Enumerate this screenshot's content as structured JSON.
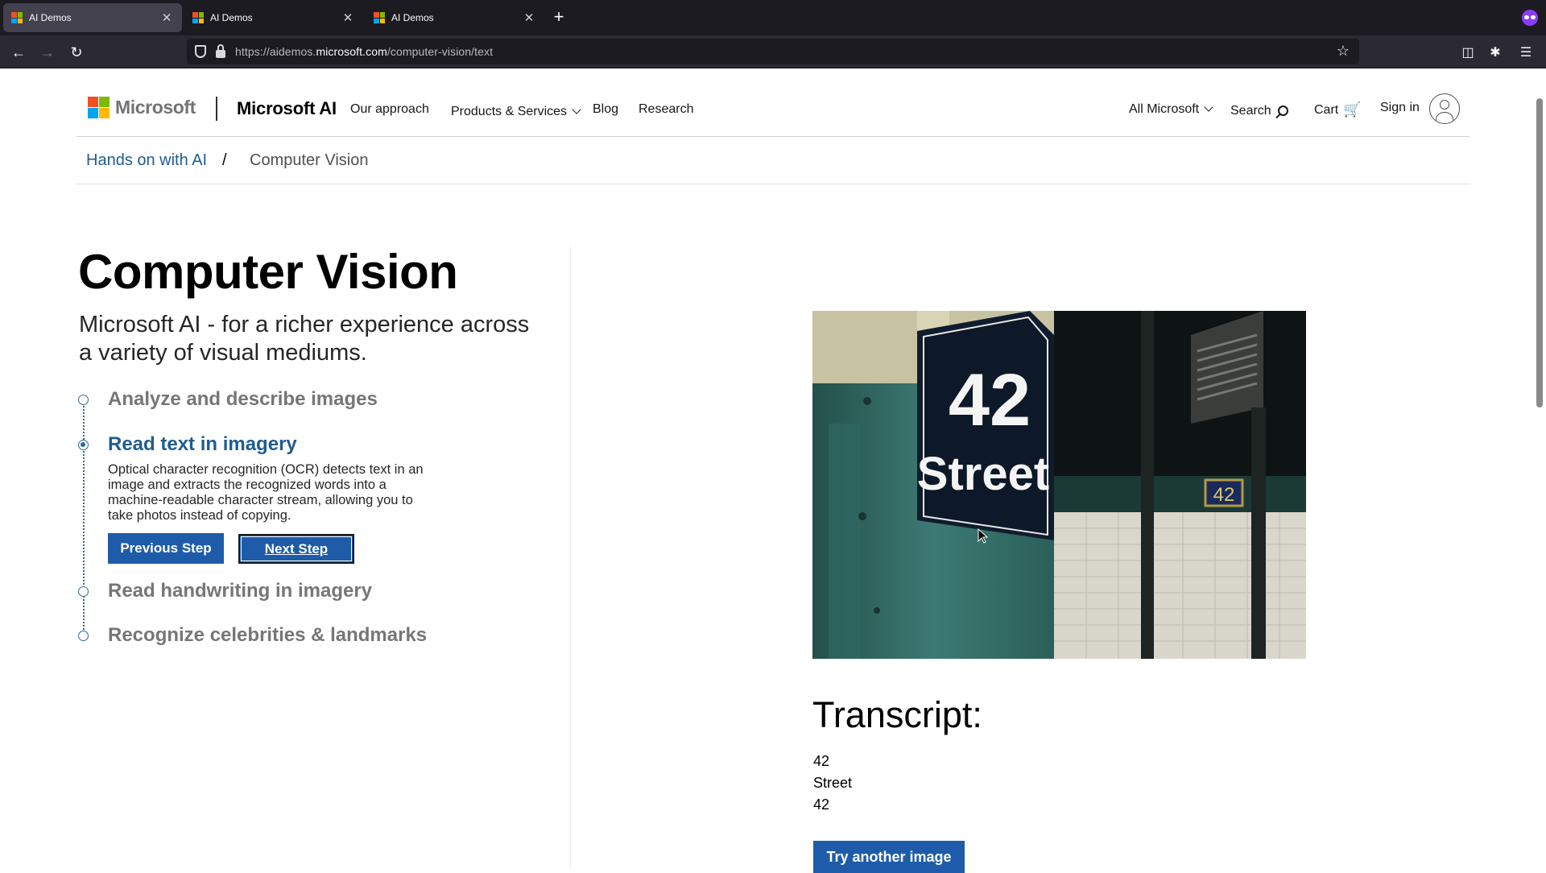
{
  "browser": {
    "tabs": [
      {
        "title": "AI Demos",
        "active": true
      },
      {
        "title": "AI Demos",
        "active": false
      },
      {
        "title": "AI Demos",
        "active": false
      }
    ],
    "new_tab": "+",
    "url_prefix": "https://aidemos.",
    "url_domain": "microsoft.com",
    "url_path": "/computer-vision/text"
  },
  "header": {
    "logo_text": "Microsoft",
    "brand": "Microsoft AI",
    "nav": [
      "Our approach",
      "Products & Services",
      "Blog",
      "Research"
    ],
    "all_microsoft": "All Microsoft",
    "search": "Search",
    "cart": "Cart",
    "sign_in": "Sign in"
  },
  "breadcrumb": {
    "link": "Hands on with AI",
    "separator": "/",
    "current": "Computer Vision"
  },
  "main": {
    "title": "Computer Vision",
    "subtitle": "Microsoft AI - for a richer experience across a variety of visual mediums.",
    "steps": [
      {
        "label": "Analyze and describe images",
        "active": false
      },
      {
        "label": "Read text in imagery",
        "active": true
      },
      {
        "label": "Read handwriting in imagery",
        "active": false
      },
      {
        "label": "Recognize celebrities & landmarks",
        "active": false
      }
    ],
    "step_description": "Optical character recognition (OCR) detects text in an image and extracts the recognized words into a machine-readable character stream, allowing you to take photos instead of copying.",
    "prev_button": "Previous Step",
    "next_button": "Next Step"
  },
  "result": {
    "sign_number": "42",
    "sign_word": "Street",
    "tile_number": "42",
    "transcript_title": "Transcript:",
    "transcript_lines": [
      "42",
      "Street",
      "42"
    ],
    "try_button": "Try another image"
  },
  "colors": {
    "accent_blue": "#1e5ca9",
    "link_blue": "#1e5c91",
    "ms_red": "#f25022",
    "ms_green": "#7fba00",
    "ms_blue": "#00a4ef",
    "ms_yellow": "#ffb900"
  }
}
